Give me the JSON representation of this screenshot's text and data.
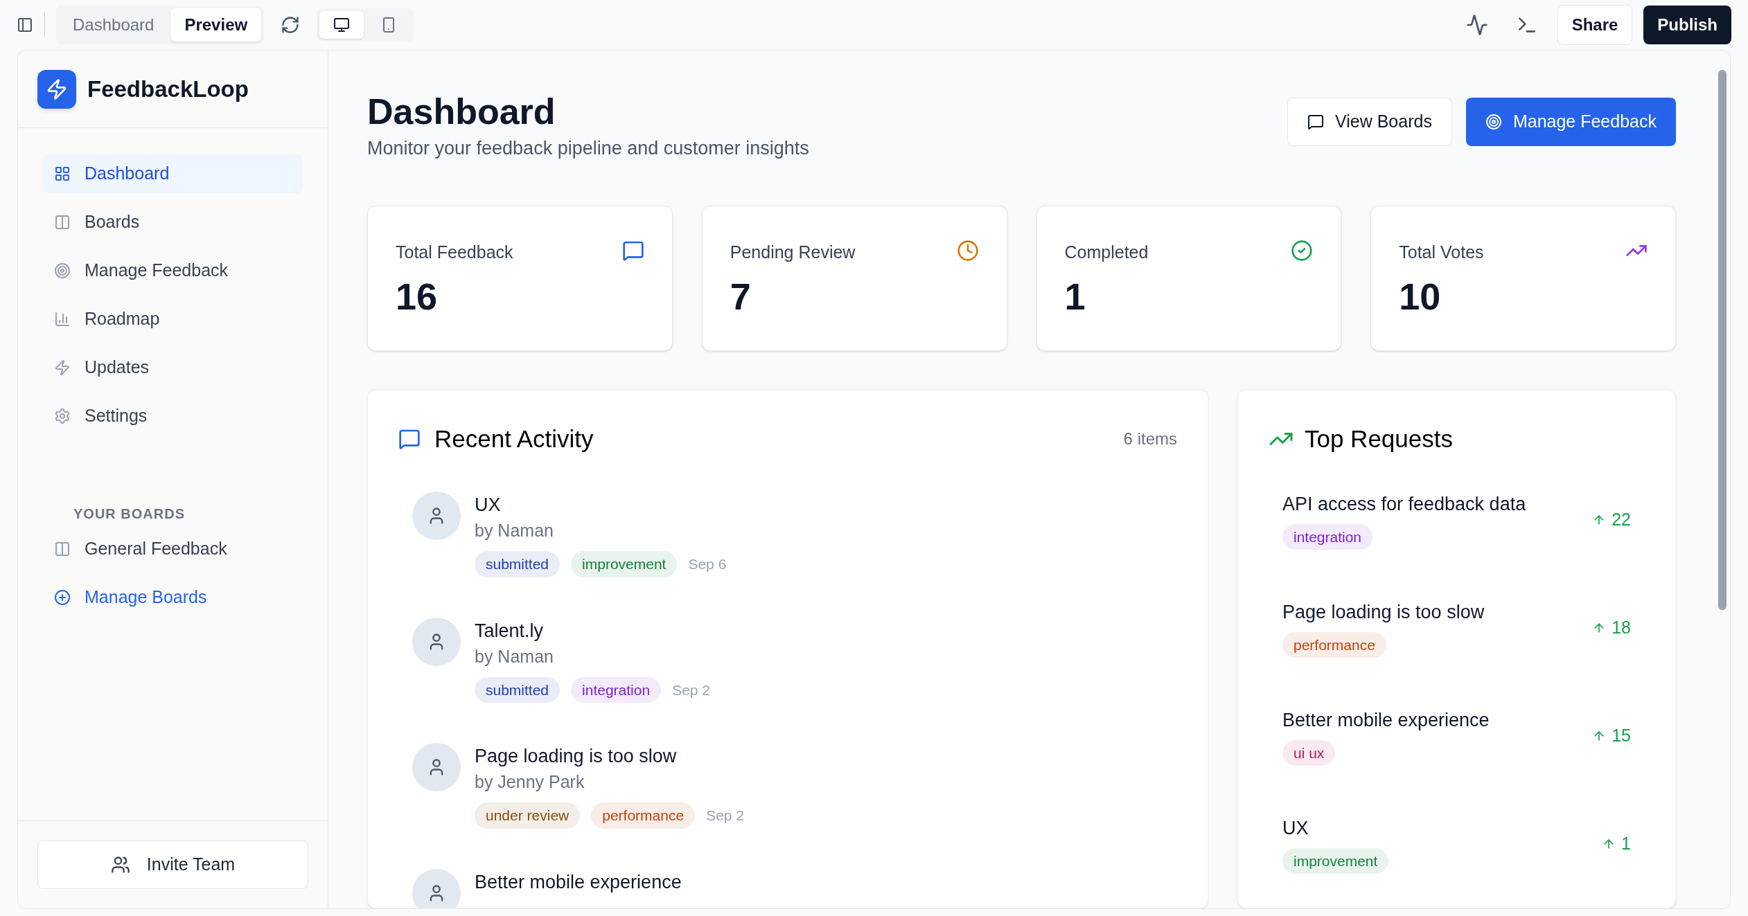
{
  "toolbar": {
    "tabs": [
      {
        "label": "Dashboard",
        "selected": false
      },
      {
        "label": "Preview",
        "selected": true
      }
    ],
    "devices": [
      {
        "kind": "desktop",
        "selected": true
      },
      {
        "kind": "mobile",
        "selected": false
      }
    ],
    "buttons": [
      {
        "label": "Share",
        "kind": "secondary"
      },
      {
        "label": "Publish",
        "kind": "primary"
      }
    ]
  },
  "sidebar": {
    "brand": "FeedbackLoop",
    "items": [
      {
        "label": "Dashboard",
        "selected": true
      },
      {
        "label": "Boards",
        "selected": false
      },
      {
        "label": "Manage Feedback",
        "selected": false
      },
      {
        "label": "Roadmap",
        "selected": false
      },
      {
        "label": "Updates",
        "selected": false
      },
      {
        "label": "Settings",
        "selected": false
      }
    ],
    "section_title": "YOUR BOARDS",
    "boards": [
      {
        "label": "General Feedback",
        "kind": "board"
      },
      {
        "label": "Manage Boards",
        "kind": "add"
      }
    ],
    "invite_button": "Invite Team"
  },
  "header": {
    "title": "Dashboard",
    "subtitle": "Monitor your feedback pipeline and customer insights",
    "buttons": [
      {
        "label": "View Boards",
        "kind": "secondary"
      },
      {
        "label": "Manage Feedback",
        "kind": "primary"
      }
    ]
  },
  "stats": [
    {
      "label": "Total Feedback",
      "value": "16",
      "color": "#2563eb"
    },
    {
      "label": "Pending Review",
      "value": "7",
      "color": "#d97706"
    },
    {
      "label": "Completed",
      "value": "1",
      "color": "#16a34a"
    },
    {
      "label": "Total Votes",
      "value": "10",
      "color": "#9333ea"
    }
  ],
  "recent_activity": {
    "title": "Recent Activity",
    "count": "6 items",
    "items": [
      {
        "title": "UX",
        "author": "by Naman",
        "tags": [
          {
            "label": "submitted",
            "color": "#1e40af"
          },
          {
            "label": "improvement",
            "color": "#15803d"
          }
        ],
        "date": "Sep 6"
      },
      {
        "title": "Talent.ly",
        "author": "by Naman",
        "tags": [
          {
            "label": "submitted",
            "color": "#1e40af"
          },
          {
            "label": "integration",
            "color": "#7e22ce"
          }
        ],
        "date": "Sep 2"
      },
      {
        "title": "Page loading is too slow",
        "author": "by Jenny Park",
        "tags": [
          {
            "label": "under review",
            "color": "#854d0e"
          },
          {
            "label": "performance",
            "color": "#c2410c"
          }
        ],
        "date": "Sep 2"
      },
      {
        "title": "Better mobile experience"
      }
    ]
  },
  "top_requests": {
    "title": "Top Requests",
    "items": [
      {
        "title": "API access for feedback data",
        "tag": {
          "label": "integration",
          "color": "#7e22ce"
        },
        "votes": "22"
      },
      {
        "title": "Page loading is too slow",
        "tag": {
          "label": "performance",
          "color": "#c2410c"
        },
        "votes": "18"
      },
      {
        "title": "Better mobile experience",
        "tag": {
          "label": "ui ux",
          "color": "#be185d"
        },
        "votes": "15"
      },
      {
        "title": "UX",
        "tag": {
          "label": "improvement",
          "color": "#15803d"
        },
        "votes": "1"
      }
    ]
  }
}
